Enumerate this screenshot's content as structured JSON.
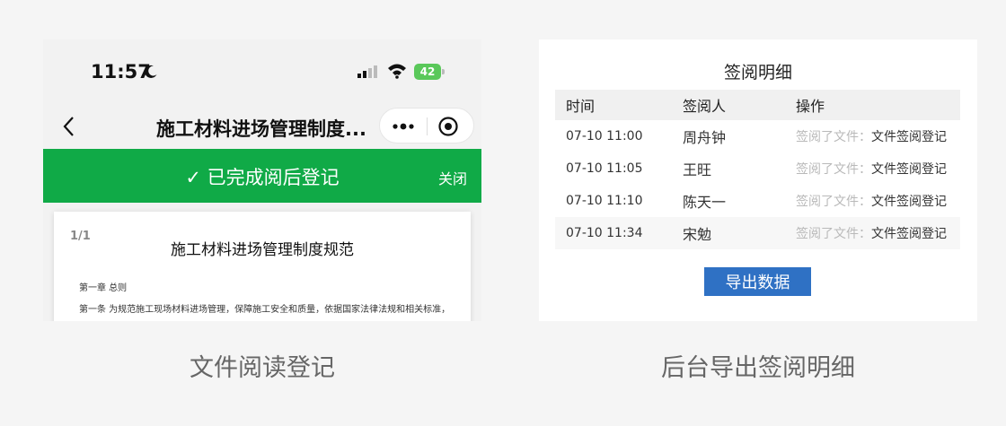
{
  "phone": {
    "status_bar": {
      "time": "11:57",
      "battery": "42"
    },
    "nav": {
      "title": "施工材料进场管理制度...",
      "icons": [
        "back-icon",
        "more-icon",
        "target-icon"
      ]
    },
    "banner": {
      "text": "✓ 已完成阅后登记",
      "close": "关闭",
      "color": "#10aa47"
    },
    "document": {
      "page": "1/1",
      "title": "施工材料进场管理制度规范",
      "lines": [
        "第一章  总则",
        "第一条  为规范施工现场材料进场管理，保障施工安全和质量，依据国家法律法规和相关标准，"
      ]
    }
  },
  "admin": {
    "title": "签阅明细",
    "columns": [
      "时间",
      "签阅人",
      "操作"
    ],
    "rows": [
      {
        "time": "07-10 11:00",
        "person": "周舟钟",
        "action_prefix": "签阅了文件：",
        "action": "文件签阅登记"
      },
      {
        "time": "07-10 11:05",
        "person": "王旺",
        "action_prefix": "签阅了文件：",
        "action": "文件签阅登记"
      },
      {
        "time": "07-10 11:10",
        "person": "陈天一",
        "action_prefix": "签阅了文件：",
        "action": "文件签阅登记"
      },
      {
        "time": "07-10 11:34",
        "person": "宋勉",
        "action_prefix": "签阅了文件：",
        "action": "文件签阅登记"
      }
    ],
    "export_button": "导出数据",
    "accent": "#2f71c4"
  },
  "captions": {
    "left": "文件阅读登记",
    "right": "后台导出签阅明细"
  }
}
